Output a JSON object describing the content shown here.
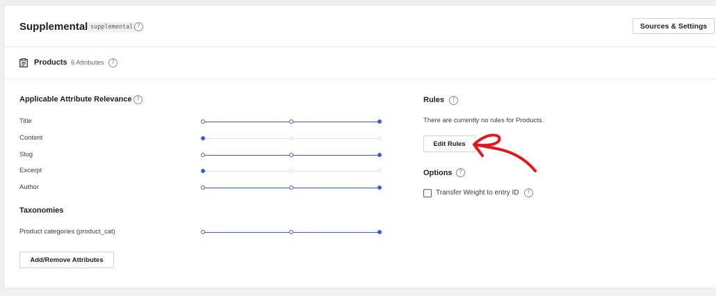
{
  "header": {
    "engine_name": "Supplemental",
    "engine_slug": "supplemental",
    "sources_button": "Sources & Settings"
  },
  "source": {
    "name": "Products",
    "attributes_count": "6 Attributes"
  },
  "relevance": {
    "title": "Applicable Attribute Relevance",
    "attributes": [
      {
        "label": "Title",
        "level": 1.0
      },
      {
        "label": "Content",
        "level": 0.0
      },
      {
        "label": "Slug",
        "level": 1.0
      },
      {
        "label": "Excerpt",
        "level": 0.0
      },
      {
        "label": "Author",
        "level": 1.0
      }
    ],
    "taxonomies_title": "Taxonomies",
    "taxonomies": [
      {
        "label": "Product categories (product_cat)",
        "level": 1.0
      }
    ],
    "add_remove_button": "Add/Remove Attributes"
  },
  "rules": {
    "title": "Rules",
    "note": "There are currently no rules for Products.",
    "edit_button": "Edit Rules"
  },
  "options": {
    "title": "Options",
    "transfer_weight_label": "Transfer Weight to entry ID",
    "transfer_weight_checked": false
  },
  "colors": {
    "accent": "#3858e9",
    "annotation_arrow": "#e8141c"
  },
  "icons": {
    "help": "question-circle-icon",
    "products": "post-list-icon"
  }
}
